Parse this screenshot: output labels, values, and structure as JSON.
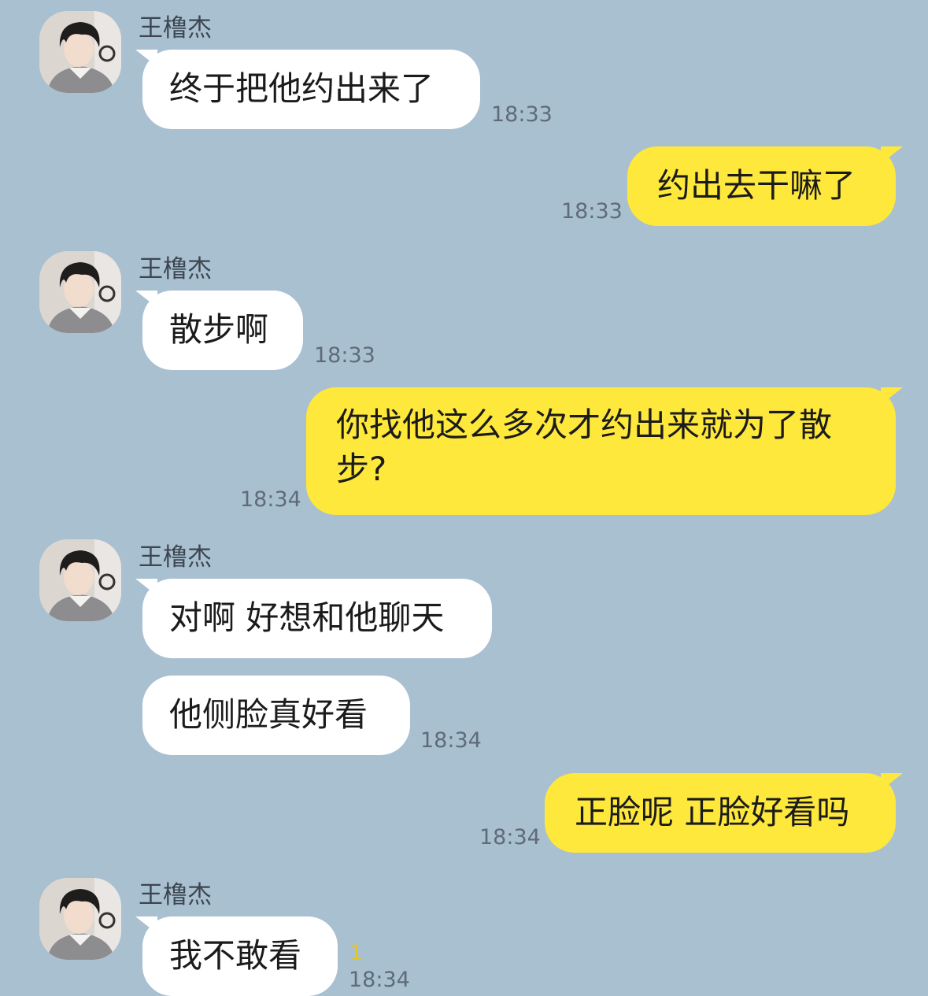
{
  "chat": {
    "contact_name": "王橹杰",
    "colors": {
      "background": "#a9c0d1",
      "incoming_bubble": "#ffffff",
      "outgoing_bubble": "#fee83b",
      "time_text": "#5f6b78",
      "unread_count": "#e3c626"
    },
    "messages": [
      {
        "sender": "王橹杰",
        "text": "终于把他约出来了",
        "time": "18:33"
      },
      {
        "sender": "me",
        "text": "约出去干嘛了",
        "time": "18:33"
      },
      {
        "sender": "王橹杰",
        "text": "散步啊",
        "time": "18:33"
      },
      {
        "sender": "me",
        "text": "你找他这么多次才约出来就为了散步?",
        "time": "18:34"
      },
      {
        "sender": "王橹杰",
        "text": "对啊 好想和他聊天",
        "time": ""
      },
      {
        "sender": "王橹杰",
        "text": "他侧脸真好看",
        "time": "18:34"
      },
      {
        "sender": "me",
        "text": "正脸呢 正脸好看吗",
        "time": "18:34"
      },
      {
        "sender": "王橹杰",
        "text": "我不敢看",
        "time": "18:34",
        "unread": "1"
      }
    ]
  }
}
